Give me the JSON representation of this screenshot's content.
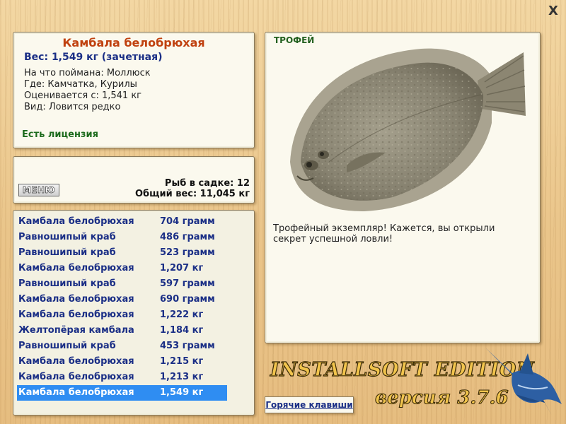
{
  "close_label": "X",
  "fish_info": {
    "title": "Камбала белобрюхая",
    "weight": "Вес: 1,549 кг (зачетная)",
    "bait": "На что поймана: Моллюск",
    "location": "Где: Камчатка, Курилы",
    "rating": "Оценивается с: 1,541 кг",
    "kind": "Вид: Ловится редко",
    "license": "Есть лицензия"
  },
  "cage": {
    "menu_label": "МЕНЮ",
    "count": "Рыб в садке: 12",
    "total": "Общий вес: 11,045 кг"
  },
  "catch_list": [
    {
      "name": "Камбала белобрюхая",
      "weight": "704 грамм"
    },
    {
      "name": "Равношипый краб",
      "weight": "486 грамм"
    },
    {
      "name": "Равношипый краб",
      "weight": "523 грамм"
    },
    {
      "name": "Камбала белобрюхая",
      "weight": "1,207 кг"
    },
    {
      "name": "Равношипый краб",
      "weight": "597 грамм"
    },
    {
      "name": "Камбала белобрюхая",
      "weight": "690 грамм"
    },
    {
      "name": "Камбала белобрюхая",
      "weight": "1,222 кг"
    },
    {
      "name": "Желтопёрая камбала",
      "weight": "1,184 кг"
    },
    {
      "name": "Равношипый краб",
      "weight": "453 грамм"
    },
    {
      "name": "Камбала белобрюхая",
      "weight": "1,215 кг"
    },
    {
      "name": "Камбала белобрюхая",
      "weight": "1,213 кг"
    },
    {
      "name": "Камбала белобрюхая",
      "weight": "1,549 кг"
    }
  ],
  "selected_index": 11,
  "trophy": {
    "label": "ТРОФЕЙ",
    "message": "Трофейный экземпляр! Кажется, вы открыли секрет успешной ловли!",
    "image_icon": "flounder-image"
  },
  "branding": {
    "edition": "INSTALLSOFT EDITION",
    "version": "версия 3.7.6"
  },
  "hotkeys_label": "Горячие клавиши",
  "colors": {
    "title": "#c0410f",
    "list_text": "#1b2f86",
    "selection": "#2f8df2",
    "license": "#1d6b1d"
  }
}
